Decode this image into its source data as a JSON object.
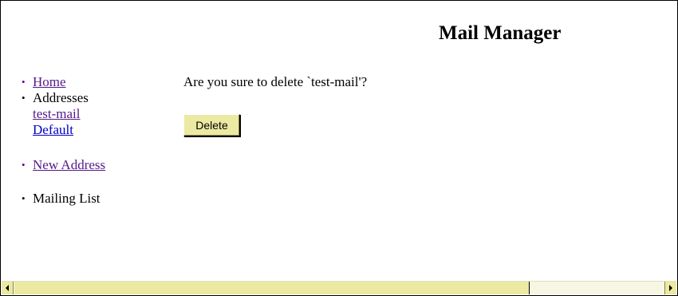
{
  "header": {
    "title": "Mail Manager"
  },
  "sidebar": {
    "bullet_glyph": "•",
    "home_label": "Home",
    "addresses_label": "Addresses",
    "addresses": [
      {
        "label": "test-mail"
      },
      {
        "label": "Default"
      }
    ],
    "new_address_label": "New Address",
    "mailing_list_label": "Mailing List"
  },
  "main": {
    "prompt": "Are you sure to delete `test-mail'?",
    "delete_label": "Delete"
  },
  "colors": {
    "visited_link": "#551a8b",
    "unvisited_link": "#0000cc",
    "button_face": "#ece9a3",
    "scroll_track": "#f7f6e3"
  },
  "icons": {
    "scroll_left": "triangle-left-icon",
    "scroll_right": "triangle-right-icon",
    "bullet": "bullet-icon"
  }
}
